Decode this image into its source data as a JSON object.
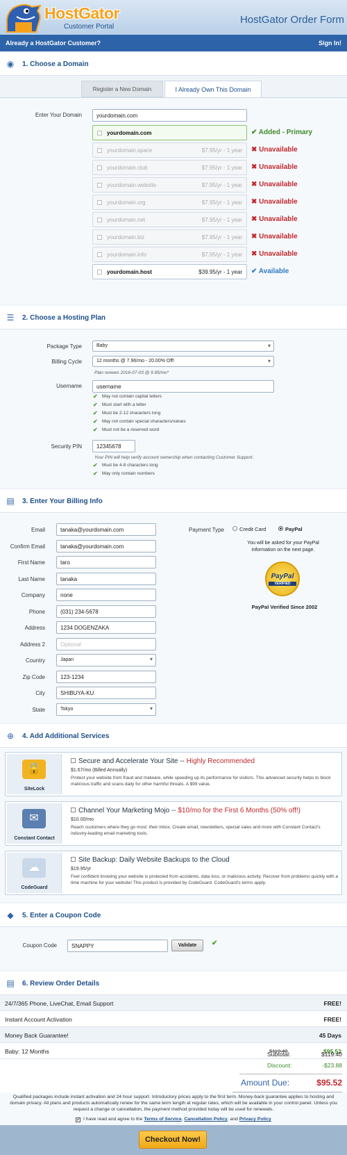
{
  "header": {
    "brand": "HostGator",
    "brand_sub": "Customer Portal",
    "title": "HostGator Order Form"
  },
  "bar": {
    "left": "Already a HostGator Customer?",
    "right": "Sign In!"
  },
  "s1": {
    "title": "1. Choose a Domain",
    "tab1": "Register a New Domain",
    "tab2": "I Already Own This Domain",
    "label": "Enter Your Domain",
    "value": "yourdomain.com",
    "rows": [
      {
        "name": "yourdomain.com",
        "price": "",
        "status": "✔ Added - Primary",
        "kind": "prim"
      },
      {
        "name": "yourdomain.space",
        "price": "$7.95/yr - 1 year",
        "status": "✖ Unavailable",
        "kind": "bad"
      },
      {
        "name": "yourdomain.club",
        "price": "$7.95/yr - 1 year",
        "status": "✖ Unavailable",
        "kind": "bad"
      },
      {
        "name": "yourdomain.website",
        "price": "$7.95/yr - 1 year",
        "status": "✖ Unavailable",
        "kind": "bad"
      },
      {
        "name": "yourdomain.org",
        "price": "$7.95/yr - 1 year",
        "status": "✖ Unavailable",
        "kind": "bad"
      },
      {
        "name": "yourdomain.net",
        "price": "$7.95/yr - 1 year",
        "status": "✖ Unavailable",
        "kind": "bad"
      },
      {
        "name": "yourdomain.biz",
        "price": "$7.95/yr - 1 year",
        "status": "✖ Unavailable",
        "kind": "bad"
      },
      {
        "name": "yourdomain.info",
        "price": "$7.95/yr - 1 year",
        "status": "✖ Unavailable",
        "kind": "bad"
      },
      {
        "name": "yourdomain.host",
        "price": "$39.95/yr - 1 year",
        "status": "✔ Available",
        "kind": "good"
      }
    ]
  },
  "s2": {
    "title": "2. Choose a Hosting Plan",
    "pkg_label": "Package Type",
    "pkg": "Baby",
    "cycle_label": "Billing Cycle",
    "cycle": "12 months @ 7.96/mo - 20.00% Off!",
    "renew": "Plan renews 2016-07-03 @ 9.95/mo*",
    "user_label": "Username",
    "user": "username",
    "user_rules": [
      "May not contain capital letters",
      "Must start with a letter",
      "Must be 2-12 characters long",
      "May not contain special characters/values",
      "Must not be a reserved word"
    ],
    "pin_label": "Security PIN",
    "pin": "12345678",
    "pin_hint": "Your PIN will help verify account ownership when contacting Customer Support.",
    "pin_rules": [
      "Must be 4-8 characters long",
      "May only contain numbers"
    ]
  },
  "s3": {
    "title": "3. Enter Your Billing Info",
    "fields": [
      {
        "label": "Email",
        "value": "tanaka@yourdomain.com"
      },
      {
        "label": "Confirm Email",
        "value": "tanaka@yourdomain.com"
      },
      {
        "label": "First Name",
        "value": "taro"
      },
      {
        "label": "Last Name",
        "value": "tanaka"
      },
      {
        "label": "Company",
        "value": "none"
      },
      {
        "label": "Phone",
        "value": "(031) 234-5678"
      },
      {
        "label": "Address",
        "value": "1234 DOGENZAKA"
      },
      {
        "label": "Address 2",
        "value": "",
        "placeholder": "Optional"
      },
      {
        "label": "Country",
        "value": "Japan"
      },
      {
        "label": "Zip Code",
        "value": "123-1234"
      },
      {
        "label": "City",
        "value": "SHIBUYA-KU"
      },
      {
        "label": "State",
        "value": "Tokyo"
      }
    ],
    "pay_label": "Payment Type",
    "pay_cc": "Credit Card",
    "pay_pp": "PayPal",
    "pay_note": "You will be asked for your PayPal information on the next page.",
    "seal_top": "PayPal",
    "seal_bot": "VERIFIED",
    "pay_verified": "PayPal Verified Since 2002"
  },
  "s4": {
    "title": "4. Add Additional Services",
    "services": [
      {
        "logo": "SiteLock",
        "title": "Secure and Accelerate Your Site -- ",
        "title_hl": "Highly Recommended",
        "price": "$1.67/mo (Billed Annually)",
        "desc": "Protect your website from fraud and malware, while speeding up its performance for visitors. This advanced security helps to block malicious traffic and scans daily for other harmful threats. A $99 value."
      },
      {
        "logo": "Constant Contact",
        "title": "Channel Your Marketing Mojo -- ",
        "title_hl": "$10/mo for the First 6 Months (50% off!)",
        "price": "$10.00/mo",
        "desc": "Reach customers where they go most: their inbox. Create email, newsletters, special sales and more with Constant Contact's industry-leading email marketing tools."
      },
      {
        "logo": "CodeGuard",
        "title": "Site Backup: Daily Website Backups to the Cloud",
        "title_hl": "",
        "price": "$19.95/yr",
        "desc": "Feel confident knowing your website is protected from accidents, data loss, or malicious activity. Recover from problems quickly with a time machine for your website! This product is provided by CodeGuard. CodeGuard's terms apply."
      }
    ]
  },
  "s5": {
    "title": "5. Enter a Coupon Code",
    "label": "Coupon Code",
    "value": "SNAPPY",
    "btn": "Validate"
  },
  "s6": {
    "title": "6. Review Order Details",
    "rows": [
      {
        "a": "24/7/365 Phone, LiveChat, Email Support",
        "b": "FREE!"
      },
      {
        "a": "Instant Account Activation",
        "b": "FREE!"
      },
      {
        "a": "Money Back Guarantee!",
        "b": "45 Days"
      }
    ],
    "plan": "Baby: 12 Months",
    "plan_old": "$119.40",
    "plan_new": "$95.52",
    "subtotal_l": "Subtotal:",
    "subtotal": "$119.40",
    "discount_l": "Discount:",
    "discount": "-$23.88",
    "due_l": "Amount Due:",
    "due": "$95.52",
    "foot": "Qualified packages include instant activation and 24 hour support. Introductory prices apply to the first term. Money-back guarantee applies to hosting and domain privacy. All plans and products automatically renew for the same term length at regular rates, which will be available in your control panel. Unless you request a change or cancellation, the payment method provided today will be used for renewals.",
    "agree": "I have read and agree to the",
    "tos": "Terms of Service",
    "cancel": "Cancellation Policy",
    "and": ", and",
    "privacy": "Privacy Policy",
    "checkout": "Checkout Now!"
  },
  "colors": {
    "brand": "#2d63a8",
    "accent": "#f5a21a",
    "error": "#c0272d",
    "success": "#48a22c"
  }
}
